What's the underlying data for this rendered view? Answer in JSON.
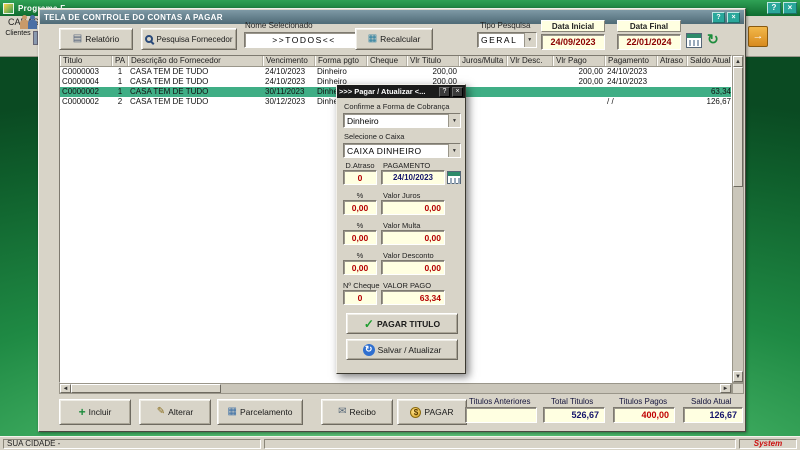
{
  "colors": {
    "desktop_green": "#1f8a44",
    "titlebar_teal_buttons": "#2aa79b",
    "selected_row": "#3fae85",
    "value_red": "#b40000",
    "value_navy": "#15156b",
    "field_yellow": "#ffffe1"
  },
  "icons": {
    "help": "?",
    "close": "×",
    "arrow_down": "▼",
    "arrow_up": "▲",
    "arrow_left": "◄",
    "arrow_right": "►",
    "printer": "▤",
    "calc": "▦",
    "refresh": "↻",
    "plus": "+",
    "pencil": "✎",
    "grid": "▦",
    "receipt": "✉",
    "coin": "$",
    "check": "✓",
    "sync": "↻",
    "exit_arrow": "→"
  },
  "desktop": {
    "app_title": "Programa F",
    "menu": "CADASTROS",
    "toolbar_icon_label": "Clientes",
    "statusbar_left": "SUA CIDADE - ",
    "statusbar_brand": "System"
  },
  "window": {
    "title": "TELA DE CONTROLE DO CONTAS A PAGAR",
    "toolbar": {
      "relatorio": "Relatório",
      "pesquisa_fornecedor": "Pesquisa Fornecedor",
      "nome_selecionado_label": "Nome Selecionado",
      "nome_selecionado_value": ">>TODOS<<",
      "recalcular": "Recalcular",
      "tipo_pesquisa_label": "Tipo Pesquisa",
      "tipo_pesquisa_value": "GERAL",
      "data_inicial_label": "Data Inicial",
      "data_inicial_value": "24/09/2023",
      "data_final_label": "Data Final",
      "data_final_value": "22/01/2024"
    },
    "table": {
      "columns": [
        "Titulo",
        "PA",
        "Descrição do Fornecedor",
        "Vencimento",
        "Forma pgto",
        "Cheque",
        "Vlr Titulo",
        "Juros/Multa",
        "Vlr Desc.",
        "Vlr Pago",
        "Pagamento",
        "Atraso",
        "Saldo Atual"
      ],
      "rows": [
        [
          "C0000003",
          "1",
          "CASA TEM DE TUDO",
          "24/10/2023",
          "Dinheiro",
          "",
          "200,00",
          "",
          "",
          "200,00",
          "24/10/2023",
          "",
          ""
        ],
        [
          "C0000004",
          "1",
          "CASA TEM DE TUDO",
          "24/10/2023",
          "Dinheiro",
          "",
          "200,00",
          "",
          "",
          "200,00",
          "24/10/2023",
          "",
          ""
        ],
        [
          "C0000002",
          "1",
          "CASA TEM DE TUDO",
          "30/11/2023",
          "Dinheiro",
          "",
          "",
          "",
          "",
          "",
          "",
          "",
          "63,34"
        ],
        [
          "C0000002",
          "2",
          "CASA TEM DE TUDO",
          "30/12/2023",
          "Dinheiro",
          "",
          "",
          "",
          "",
          "",
          "/  /",
          "",
          "126,67"
        ]
      ],
      "selected_index": 2
    },
    "footer": {
      "buttons": [
        "Incluir",
        "Alterar",
        "Parcelamento",
        "Recibo",
        "PAGAR"
      ],
      "summary": [
        {
          "label": "Titulos Anteriores",
          "value": ""
        },
        {
          "label": "Total Titulos",
          "value": "526,67"
        },
        {
          "label": "Titulos Pagos",
          "value": "400,00"
        },
        {
          "label": "Saldo Atual",
          "value": "126,67"
        }
      ]
    }
  },
  "modal": {
    "title": ">>> Pagar / Atualizar <...",
    "forma_cobranca_label": "Confirme a Forma de Cobrança",
    "forma_cobranca_value": "Dinheiro",
    "caixa_label": "Selecione o Caixa",
    "caixa_value": "CAIXA DINHEIRO",
    "fields": [
      {
        "left_label": "D.Atraso",
        "right_label": "PAGAMENTO",
        "left_value": "0",
        "right_value": "24/10/2023"
      },
      {
        "left_label": "%",
        "right_label": "Valor Juros",
        "left_value": "0,00",
        "right_value": "0,00"
      },
      {
        "left_label": "%",
        "right_label": "Valor Multa",
        "left_value": "0,00",
        "right_value": "0,00"
      },
      {
        "left_label": "%",
        "right_label": "Valor Desconto",
        "left_value": "0,00",
        "right_value": "0,00"
      },
      {
        "left_label": "Nº Cheque",
        "right_label": "VALOR PAGO",
        "left_value": "0",
        "right_value": "63,34"
      }
    ],
    "pagar_button": "PAGAR TITULO",
    "salvar_button": "Salvar / Atualizar"
  }
}
